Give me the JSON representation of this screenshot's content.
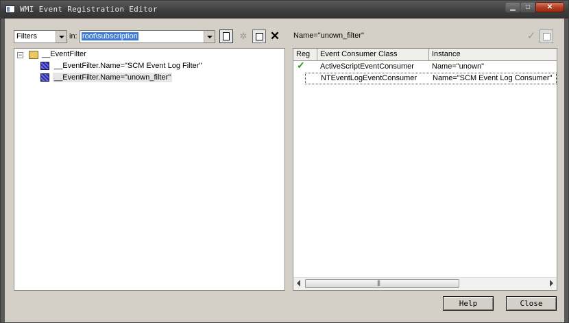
{
  "window": {
    "title": "WMI Event Registration Editor"
  },
  "left": {
    "filter_type": "Filters",
    "in_label": "in:",
    "namespace": "root\\subscription",
    "tree": {
      "root_label": "__EventFilter",
      "expander": "−",
      "children": [
        "__EventFilter.Name=\"SCM Event Log Filter\"",
        "__EventFilter.Name=\"unown_filter\""
      ]
    }
  },
  "right": {
    "path": "Name=\"unown_filter\"",
    "columns": [
      "Reg",
      "Event Consumer Class",
      "Instance"
    ],
    "rows": [
      {
        "registered": true,
        "class": "ActiveScriptEventConsumer",
        "instance": "Name=\"unown\""
      },
      {
        "registered": false,
        "class": "NTEventLogEventConsumer",
        "instance": "Name=\"SCM Event Log Consumer\""
      }
    ]
  },
  "buttons": {
    "help": "Help",
    "close": "Close"
  },
  "icons": {
    "reg_check": "✓",
    "apply": "✓",
    "delete": "✕",
    "wand": "✲",
    "min": "▁",
    "max": "□",
    "close": "✕"
  }
}
